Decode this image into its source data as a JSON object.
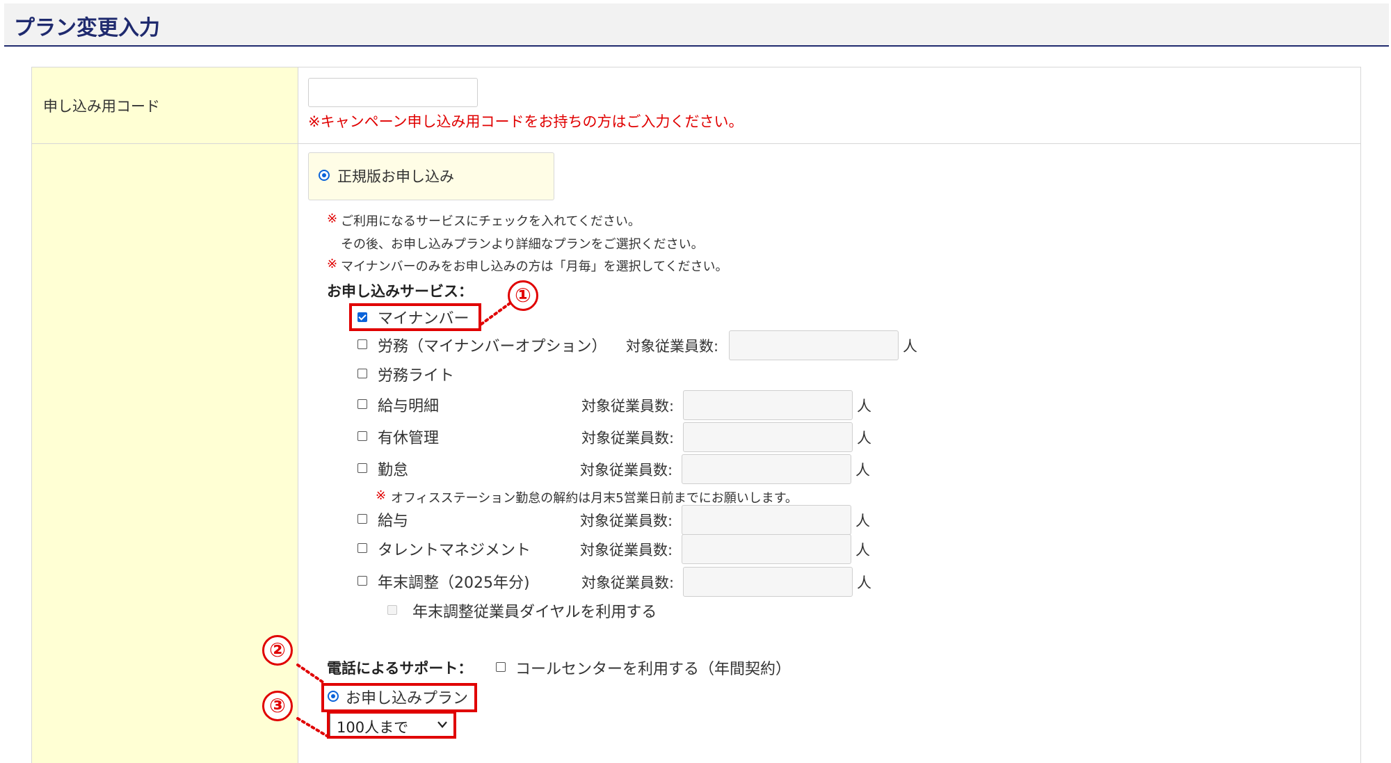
{
  "page": {
    "title": "プラン変更入力"
  },
  "code_row": {
    "label": "申し込み用コード",
    "input_value": "",
    "note": "※キャンペーン申し込み用コードをお持ちの方はご入力ください。"
  },
  "apply_type": {
    "label": "正規版お申し込み",
    "selected": true
  },
  "notes": {
    "mark": "※",
    "line1": "ご利用になるサービスにチェックを入れてください。",
    "line2": "その後、お申し込みプランより詳細なプランをご選択ください。",
    "line3": "マイナンバーのみをお申し込みの方は「月毎」を選択してください。"
  },
  "services_heading": "お申し込みサービス：",
  "count_label": "対象従業員数:",
  "unit": "人",
  "services": [
    {
      "label": "マイナンバー",
      "checked": true
    },
    {
      "label": "労務（マイナンバーオプション）",
      "checked": false
    },
    {
      "label": "労務ライト",
      "checked": false
    },
    {
      "label": "給与明細",
      "checked": false
    },
    {
      "label": "有休管理",
      "checked": false
    },
    {
      "label": "勤怠",
      "checked": false
    },
    {
      "label": "給与",
      "checked": false
    },
    {
      "label": "タレントマネジメント",
      "checked": false
    },
    {
      "label": "年末調整（2025年分)",
      "checked": false
    }
  ],
  "kintai_note": "オフィスステーション勤怠の解約は月末5営業日前までにお願いします。",
  "yearend_dial": {
    "label": "年末調整従業員ダイヤルを利用する",
    "checked": false,
    "disabled": true
  },
  "phone_support": {
    "label": "電話によるサポート：",
    "option_label": "コールセンターを利用する（年間契約）",
    "checked": false
  },
  "plan": {
    "radio_label": "お申し込みプラン",
    "selected": true,
    "select_value": "100人まで"
  },
  "callouts": [
    "①",
    "②",
    "③"
  ],
  "colors": {
    "accent": "#1f2a6e",
    "label_bg": "#ffffd4",
    "highlight": "#e00000",
    "control_blue": "#0b63d9"
  }
}
